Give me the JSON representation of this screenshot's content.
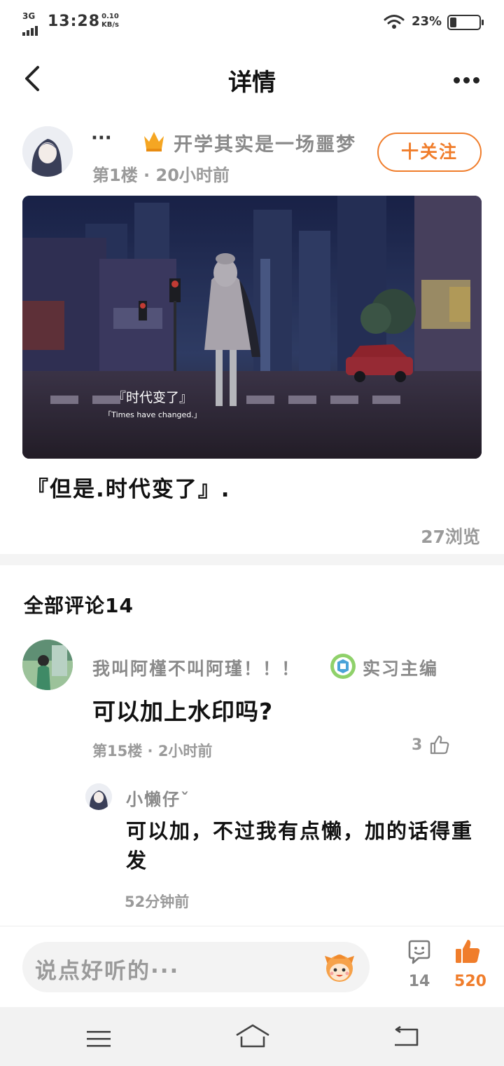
{
  "status_bar": {
    "network": "3G",
    "time": "13:28",
    "speed_value": "0.10",
    "speed_unit": "KB/s",
    "battery_percent": "23%",
    "battery_level": 0.23
  },
  "nav": {
    "title": "详情"
  },
  "post": {
    "author_name": "···",
    "group_name": "开学其实是一场噩梦",
    "meta": "第1楼 · 20小时前",
    "follow_label": "十关注",
    "image_caption_zh": "『时代变了』",
    "image_caption_en": "「Times have changed.」",
    "text": "『但是.时代变了』.",
    "views": "27浏览"
  },
  "comments": {
    "title": "全部评论14",
    "items": [
      {
        "name": "我叫阿槿不叫阿瑾！！！",
        "badge": "实习主编",
        "text": "可以加上水印吗?",
        "meta": "第15楼 · 2小时前",
        "likes": "3",
        "reply": {
          "name": "小懒仔ˇ",
          "text": "可以加，不过我有点懒，加的话得重发",
          "meta": "52分钟前"
        }
      }
    ]
  },
  "input_bar": {
    "placeholder": "说点好听的···",
    "comment_count": "14",
    "like_count": "520"
  },
  "colors": {
    "accent": "#f07d2b",
    "muted_text": "#9a9a9a"
  },
  "icons": [
    "back-icon",
    "more-icon",
    "crown-icon",
    "badge-icon",
    "thumb-up-icon",
    "emoji-icon",
    "comment-icon",
    "menu-icon",
    "home-icon",
    "system-back-icon"
  ]
}
